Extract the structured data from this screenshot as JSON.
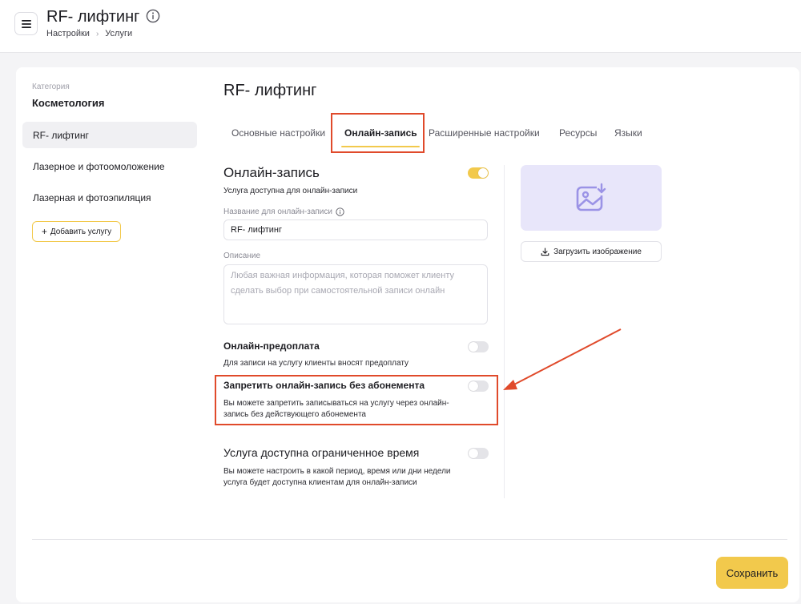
{
  "header": {
    "title": "RF- лифтинг",
    "breadcrumb": [
      "Настройки",
      "Услуги"
    ],
    "menu_icon": "hamburger-icon",
    "info_icon": "info-icon"
  },
  "sidebar": {
    "category_label": "Категория",
    "category_name": "Косметология",
    "items": [
      {
        "label": "RF- лифтинг",
        "active": true
      },
      {
        "label": "Лазерное и фотоомоложение",
        "active": false
      },
      {
        "label": "Лазерная и фотоэпиляция",
        "active": false
      }
    ],
    "add_button": "Добавить услугу"
  },
  "main": {
    "title": "RF- лифтинг",
    "tabs": [
      {
        "label": "Основные настройки",
        "active": false
      },
      {
        "label": "Онлайн-запись",
        "active": true
      },
      {
        "label": "Расширенные настройки",
        "active": false
      },
      {
        "label": "Ресурсы",
        "active": false
      },
      {
        "label": "Языки",
        "active": false
      }
    ],
    "online": {
      "title": "Онлайн-запись",
      "subtitle": "Услуга доступна для онлайн-записи",
      "enabled": true
    },
    "name_field": {
      "label": "Название для онлайн-записи",
      "value": "RF- лифтинг"
    },
    "description_field": {
      "label": "Описание",
      "placeholder": "Любая важная информация, которая поможет клиенту сделать выбор при самостоятельной записи онлайн"
    },
    "prepayment": {
      "title": "Онлайн-предоплата",
      "description": "Для записи на услугу клиенты вносят предоплату",
      "enabled": false
    },
    "no_subscription": {
      "title": "Запретить онлайн-запись без абонемента",
      "description": "Вы можете запретить записываться на услугу через онлайн-запись без действующего абонемента",
      "enabled": false
    },
    "limited_time": {
      "title": "Услуга доступна ограниченное время",
      "description": "Вы можете настроить в какой период, время или дни недели услуга будет доступна клиентам для онлайн-записи",
      "enabled": false
    }
  },
  "image": {
    "placeholder_icon": "image-download-icon",
    "upload_label": "Загрузить изображение",
    "upload_icon": "download-icon"
  },
  "footer": {
    "save_label": "Сохранить"
  },
  "colors": {
    "accent": "#f2c94c",
    "annotation": "#e04a2b",
    "image_bg": "#e8e6fa",
    "image_icon": "#9b93e6"
  }
}
